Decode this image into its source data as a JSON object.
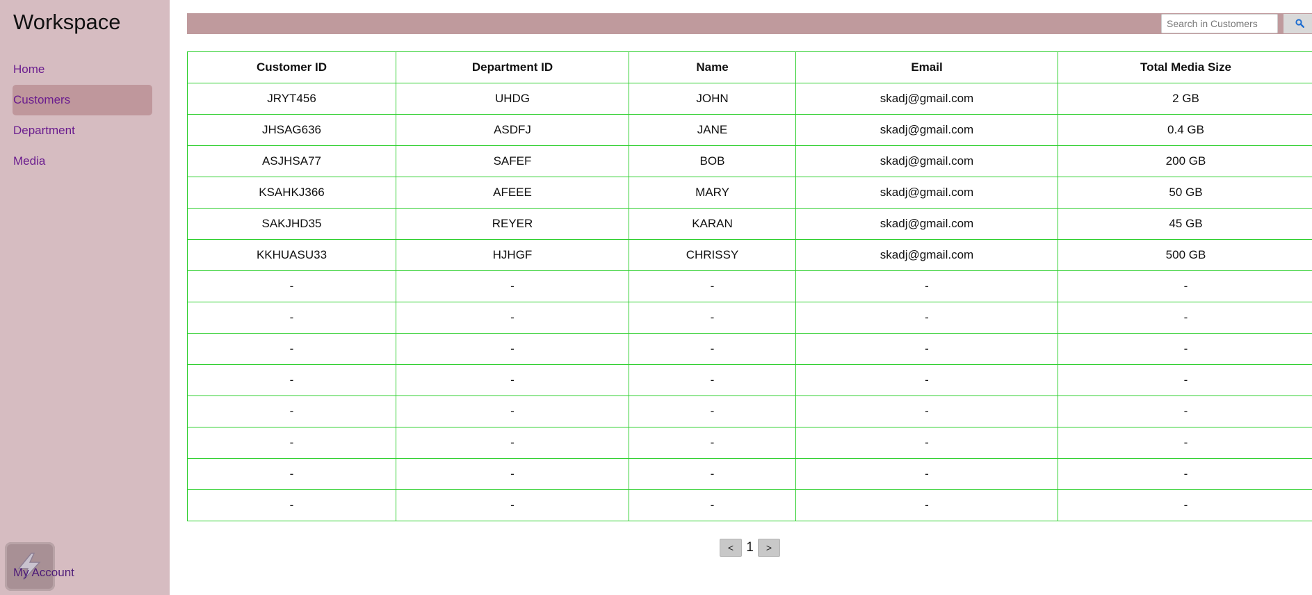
{
  "app": {
    "title": "Workspace"
  },
  "sidebar": {
    "items": [
      {
        "label": "Home",
        "active": false
      },
      {
        "label": "Customers",
        "active": true
      },
      {
        "label": "Department",
        "active": false
      },
      {
        "label": "Media",
        "active": false
      }
    ],
    "account_label": "My Account",
    "account_icon": "account-app-icon"
  },
  "search": {
    "placeholder": "Search in Customers",
    "value": "",
    "button_icon": "search-icon"
  },
  "table": {
    "columns": [
      "Customer ID",
      "Department ID",
      "Name",
      "Email",
      "Total Media Size"
    ],
    "rows": [
      [
        "JRYT456",
        "UHDG",
        "JOHN",
        "skadj@gmail.com",
        "2 GB"
      ],
      [
        "JHSAG636",
        "ASDFJ",
        "JANE",
        "skadj@gmail.com",
        "0.4 GB"
      ],
      [
        "ASJHSA77",
        "SAFEF",
        "BOB",
        "skadj@gmail.com",
        "200 GB"
      ],
      [
        "KSAHKJ366",
        "AFEEE",
        "MARY",
        "skadj@gmail.com",
        "50 GB"
      ],
      [
        "SAKJHD35",
        "REYER",
        "KARAN",
        "skadj@gmail.com",
        "45 GB"
      ],
      [
        "KKHUASU33",
        "HJHGF",
        "CHRISSY",
        "skadj@gmail.com",
        "500 GB"
      ],
      [
        "-",
        "-",
        "-",
        "-",
        "-"
      ],
      [
        "-",
        "-",
        "-",
        "-",
        "-"
      ],
      [
        "-",
        "-",
        "-",
        "-",
        "-"
      ],
      [
        "-",
        "-",
        "-",
        "-",
        "-"
      ],
      [
        "-",
        "-",
        "-",
        "-",
        "-"
      ],
      [
        "-",
        "-",
        "-",
        "-",
        "-"
      ],
      [
        "-",
        "-",
        "-",
        "-",
        "-"
      ],
      [
        "-",
        "-",
        "-",
        "-",
        "-"
      ]
    ]
  },
  "pagination": {
    "prev_label": "<",
    "current_page": "1",
    "next_label": ">"
  },
  "colors": {
    "sidebar_bg": "#d6bcc1",
    "active_item_bg": "#bf979c",
    "topbar_bg": "#bf9a9d",
    "nav_link": "#6a1c8e",
    "table_border": "#2ccf2c"
  }
}
